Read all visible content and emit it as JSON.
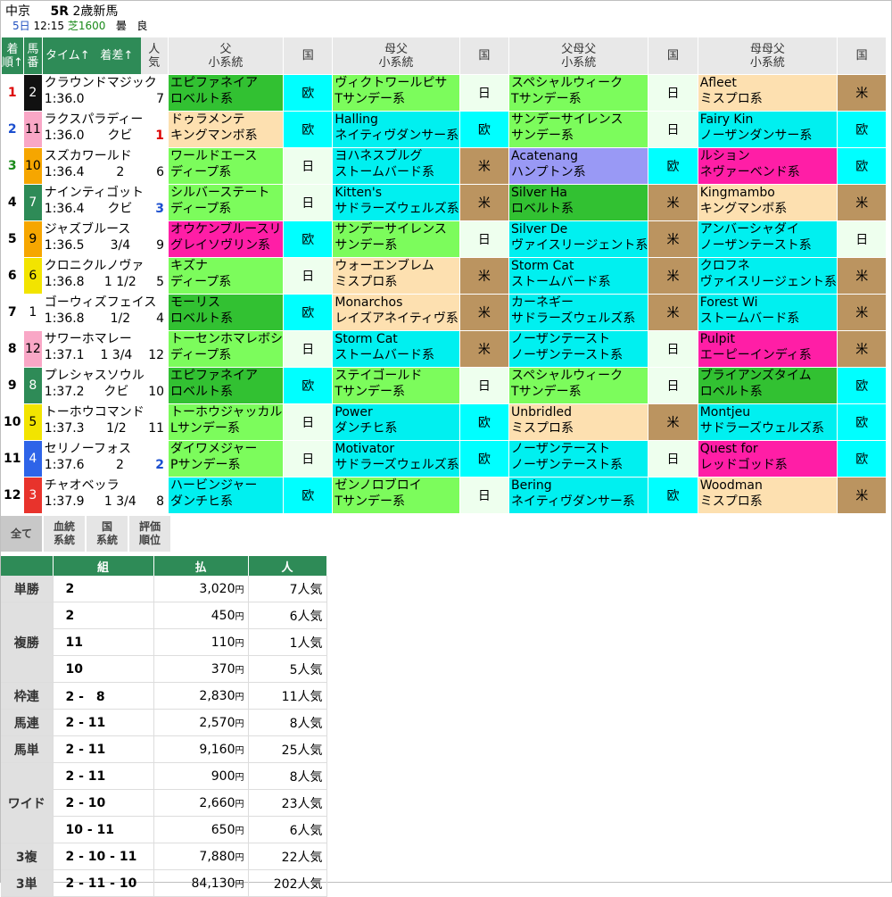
{
  "race": {
    "venue": "中京",
    "racenum": "5R",
    "class": "2歳新馬",
    "day": "5日",
    "time": "12:15",
    "course": "芝1600",
    "weather": "曇",
    "going": "良"
  },
  "headers": {
    "rank": [
      "着",
      "順↑"
    ],
    "uma": [
      "馬",
      "番"
    ],
    "time": "タイム↑",
    "margin": "着差↑",
    "pop": [
      "人",
      "気"
    ],
    "sire": [
      "父",
      "小系統"
    ],
    "kuni": "国",
    "damsire": [
      "母父",
      "小系統"
    ],
    "sire_damsire": [
      "父母父",
      "小系統"
    ],
    "dam_damsire": [
      "母母父",
      "小系統"
    ]
  },
  "colors": {
    "waku1": "#ffffff",
    "waku2": "#111111",
    "waku3": "#e8332c",
    "waku4": "#2e64e8",
    "waku5": "#f2e400",
    "waku6": "#2e8b57",
    "waku7": "#f6a600",
    "waku8": "#f9a7c6"
  },
  "horses": [
    {
      "rank": "1",
      "uma": "2",
      "waku": 2,
      "name": "クラウンドマジック",
      "time": "1:36.0",
      "margin": "",
      "pop": "7",
      "p1": [
        "エピファネイア",
        "ロベルト系"
      ],
      "c1": "c-dgreen",
      "k1": "欧",
      "kc1": "k-eu",
      "p2": [
        "ヴィクトワールピサ",
        "Tサンデー系"
      ],
      "c2": "c-green",
      "k2": "日",
      "kc2": "k-jp",
      "p3": [
        "スペシャルウィーク",
        "Tサンデー系"
      ],
      "c3": "c-green",
      "k3": "日",
      "kc3": "k-jp",
      "p4": [
        "Afleet",
        "ミスプロ系"
      ],
      "c4": "c-peach",
      "k4": "米",
      "kc4": "k-us"
    },
    {
      "rank": "2",
      "uma": "11",
      "waku": 8,
      "name": "ラクスパラディー",
      "time": "1:36.0",
      "margin": "クビ",
      "pop": "1",
      "p1": [
        "ドゥラメンテ",
        "キングマンボ系"
      ],
      "c1": "c-peach",
      "k1": "欧",
      "kc1": "k-eu",
      "p2": [
        "Halling",
        "ネイティヴダンサー系"
      ],
      "c2": "c-cyan",
      "k2": "欧",
      "kc2": "k-eu",
      "p3": [
        "サンデーサイレンス",
        "サンデー系"
      ],
      "c3": "c-green",
      "k3": "日",
      "kc3": "k-jp",
      "p4": [
        "Fairy Kin",
        "ノーザンダンサー系"
      ],
      "c4": "c-cyan",
      "k4": "欧",
      "kc4": "k-eu"
    },
    {
      "rank": "3",
      "uma": "10",
      "waku": 7,
      "name": "スズカワールド",
      "time": "1:36.4",
      "margin": "2",
      "pop": "6",
      "p1": [
        "ワールドエース",
        "ディープ系"
      ],
      "c1": "c-green",
      "k1": "日",
      "kc1": "k-jp",
      "p2": [
        "ヨハネスブルグ",
        "ストームバード系"
      ],
      "c2": "c-cyan",
      "k2": "米",
      "kc2": "k-us",
      "p3": [
        "Acatenang",
        "ハンプトン系"
      ],
      "c3": "c-purple",
      "k3": "欧",
      "kc3": "k-eu",
      "p4": [
        "ルション",
        "ネヴァーベンド系"
      ],
      "c4": "c-mag",
      "k4": "欧",
      "kc4": "k-eu"
    },
    {
      "rank": "4",
      "uma": "7",
      "waku": 6,
      "name": "ナインティゴット",
      "time": "1:36.4",
      "margin": "クビ",
      "pop": "3",
      "p1": [
        "シルバーステート",
        "ディープ系"
      ],
      "c1": "c-green",
      "k1": "日",
      "kc1": "k-jp",
      "p2": [
        "Kitten's",
        "サドラーズウェルズ系"
      ],
      "c2": "c-cyan",
      "k2": "米",
      "kc2": "k-us",
      "p3": [
        "Silver Ha",
        "ロベルト系"
      ],
      "c3": "c-dgreen",
      "k3": "米",
      "kc3": "k-us",
      "p4": [
        "Kingmambo",
        "キングマンボ系"
      ],
      "c4": "c-peach",
      "k4": "米",
      "kc4": "k-us"
    },
    {
      "rank": "5",
      "uma": "9",
      "waku": 7,
      "name": "ジャズブルース",
      "time": "1:36.5",
      "margin": "3/4",
      "pop": "9",
      "p1": [
        "オウケンブルースリ",
        "グレイソヴリン系"
      ],
      "c1": "c-mag",
      "k1": "欧",
      "kc1": "k-eu",
      "p2": [
        "サンデーサイレンス",
        "サンデー系"
      ],
      "c2": "c-green",
      "k2": "日",
      "kc2": "k-jp",
      "p3": [
        "Silver De",
        "ヴァイスリージェント系"
      ],
      "c3": "c-cyan",
      "k3": "米",
      "kc3": "k-us",
      "p4": [
        "アンバーシャダイ",
        "ノーザンテースト系"
      ],
      "c4": "c-cyan",
      "k4": "日",
      "kc4": "k-jp"
    },
    {
      "rank": "6",
      "uma": "6",
      "waku": 5,
      "name": "クロニクルノヴァ",
      "time": "1:36.8",
      "margin": "1 1/2",
      "pop": "5",
      "p1": [
        "キズナ",
        "ディープ系"
      ],
      "c1": "c-green",
      "k1": "日",
      "kc1": "k-jp",
      "p2": [
        "ウォーエンブレム",
        "ミスプロ系"
      ],
      "c2": "c-peach",
      "k2": "米",
      "kc2": "k-us",
      "p3": [
        "Storm Cat",
        "ストームバード系"
      ],
      "c3": "c-cyan",
      "k3": "米",
      "kc3": "k-us",
      "p4": [
        "クロフネ",
        "ヴァイスリージェント系"
      ],
      "c4": "c-cyan",
      "k4": "米",
      "kc4": "k-us"
    },
    {
      "rank": "7",
      "uma": "1",
      "waku": 1,
      "name": "ゴーウィズフェイス",
      "time": "1:36.8",
      "margin": "1/2",
      "pop": "4",
      "p1": [
        "モーリス",
        "ロベルト系"
      ],
      "c1": "c-dgreen",
      "k1": "欧",
      "kc1": "k-eu",
      "p2": [
        "Monarchos",
        "レイズアネイティヴ系"
      ],
      "c2": "c-peach",
      "k2": "米",
      "kc2": "k-us",
      "p3": [
        "カーネギー",
        "サドラーズウェルズ系"
      ],
      "c3": "c-cyan",
      "k3": "米",
      "kc3": "k-us",
      "p4": [
        "Forest Wi",
        "ストームバード系"
      ],
      "c4": "c-cyan",
      "k4": "米",
      "kc4": "k-us"
    },
    {
      "rank": "8",
      "uma": "12",
      "waku": 8,
      "name": "サワーホマレー",
      "time": "1:37.1",
      "margin": "1 3/4",
      "pop": "12",
      "p1": [
        "トーセンホマレボシ",
        "ディープ系"
      ],
      "c1": "c-green",
      "k1": "日",
      "kc1": "k-jp",
      "p2": [
        "Storm Cat",
        "ストームバード系"
      ],
      "c2": "c-cyan",
      "k2": "米",
      "kc2": "k-us",
      "p3": [
        "ノーザンテースト",
        "ノーザンテースト系"
      ],
      "c3": "c-cyan",
      "k3": "日",
      "kc3": "k-jp",
      "p4": [
        "Pulpit",
        "エーピーインディ系"
      ],
      "c4": "c-mag",
      "k4": "米",
      "kc4": "k-us"
    },
    {
      "rank": "9",
      "uma": "8",
      "waku": 6,
      "name": "プレシャスソウル",
      "time": "1:37.2",
      "margin": "クビ",
      "pop": "10",
      "p1": [
        "エピファネイア",
        "ロベルト系"
      ],
      "c1": "c-dgreen",
      "k1": "欧",
      "kc1": "k-eu",
      "p2": [
        "ステイゴールド",
        "Tサンデー系"
      ],
      "c2": "c-green",
      "k2": "日",
      "kc2": "k-jp",
      "p3": [
        "スペシャルウィーク",
        "Tサンデー系"
      ],
      "c3": "c-green",
      "k3": "日",
      "kc3": "k-jp",
      "p4": [
        "ブライアンズタイム",
        "ロベルト系"
      ],
      "c4": "c-dgreen",
      "k4": "欧",
      "kc4": "k-eu"
    },
    {
      "rank": "10",
      "uma": "5",
      "waku": 5,
      "name": "トーホウコマンド",
      "time": "1:37.3",
      "margin": "1/2",
      "pop": "11",
      "p1": [
        "トーホウジャッカル",
        "Lサンデー系"
      ],
      "c1": "c-green",
      "k1": "日",
      "kc1": "k-jp",
      "p2": [
        "Power",
        "ダンチヒ系"
      ],
      "c2": "c-cyan",
      "k2": "欧",
      "kc2": "k-eu",
      "p3": [
        "Unbridled",
        "ミスプロ系"
      ],
      "c3": "c-peach",
      "k3": "米",
      "kc3": "k-us",
      "p4": [
        "Montjeu",
        "サドラーズウェルズ系"
      ],
      "c4": "c-cyan",
      "k4": "欧",
      "kc4": "k-eu"
    },
    {
      "rank": "11",
      "uma": "4",
      "waku": 4,
      "name": "セリノーフォス",
      "time": "1:37.6",
      "margin": "2",
      "pop": "2",
      "p1": [
        "ダイワメジャー",
        "Pサンデー系"
      ],
      "c1": "c-green",
      "k1": "日",
      "kc1": "k-jp",
      "p2": [
        "Motivator",
        "サドラーズウェルズ系"
      ],
      "c2": "c-cyan",
      "k2": "欧",
      "kc2": "k-eu",
      "p3": [
        "ノーザンテースト",
        "ノーザンテースト系"
      ],
      "c3": "c-cyan",
      "k3": "日",
      "kc3": "k-jp",
      "p4": [
        "Quest for",
        "レッドゴッド系"
      ],
      "c4": "c-mag",
      "k4": "欧",
      "kc4": "k-eu"
    },
    {
      "rank": "12",
      "uma": "3",
      "waku": 3,
      "name": "チャオベッラ",
      "time": "1:37.9",
      "margin": "1 3/4",
      "pop": "8",
      "p1": [
        "ハービンジャー",
        "ダンチヒ系"
      ],
      "c1": "c-cyan",
      "k1": "欧",
      "kc1": "k-eu",
      "p2": [
        "ゼンノロブロイ",
        "Tサンデー系"
      ],
      "c2": "c-green",
      "k2": "日",
      "kc2": "k-jp",
      "p3": [
        "Bering",
        "ネイティヴダンサー系"
      ],
      "c3": "c-cyan",
      "k3": "欧",
      "kc3": "k-eu",
      "p4": [
        "Woodman",
        "ミスプロ系"
      ],
      "c4": "c-peach",
      "k4": "米",
      "kc4": "k-us"
    }
  ],
  "tabs": [
    [
      "全て"
    ],
    [
      "血統",
      "系統"
    ],
    [
      "国",
      "系統"
    ],
    [
      "評価",
      "順位"
    ]
  ],
  "payout_headers": {
    "kumi": "組",
    "harai": "払",
    "ninki": "人"
  },
  "yen": "円",
  "payouts": [
    {
      "type": "単勝",
      "rows": [
        {
          "kumi": "2",
          "amt": "3,020",
          "nin": "7人気"
        }
      ]
    },
    {
      "type": "複勝",
      "rows": [
        {
          "kumi": "2",
          "amt": "450",
          "nin": "6人気"
        },
        {
          "kumi": "11",
          "amt": "110",
          "nin": "1人気"
        },
        {
          "kumi": "10",
          "amt": "370",
          "nin": "5人気"
        }
      ]
    },
    {
      "type": "枠連",
      "rows": [
        {
          "kumi": "2 -　8",
          "amt": "2,830",
          "nin": "11人気"
        }
      ]
    },
    {
      "type": "馬連",
      "rows": [
        {
          "kumi": "2 - 11",
          "amt": "2,570",
          "nin": "8人気"
        }
      ]
    },
    {
      "type": "馬単",
      "rows": [
        {
          "kumi": "2 - 11",
          "amt": "9,160",
          "nin": "25人気"
        }
      ]
    },
    {
      "type": "ワイド",
      "rows": [
        {
          "kumi": "2 - 11",
          "amt": "900",
          "nin": "8人気"
        },
        {
          "kumi": "2 - 10",
          "amt": "2,660",
          "nin": "23人気"
        },
        {
          "kumi": "10 - 11",
          "amt": "650",
          "nin": "6人気"
        }
      ]
    },
    {
      "type": "3複",
      "rows": [
        {
          "kumi": "2 - 10 - 11",
          "amt": "7,880",
          "nin": "22人気"
        }
      ]
    },
    {
      "type": "3単",
      "rows": [
        {
          "kumi": "2 - 11 - 10",
          "amt": "84,130",
          "nin": "202人気"
        }
      ]
    }
  ]
}
